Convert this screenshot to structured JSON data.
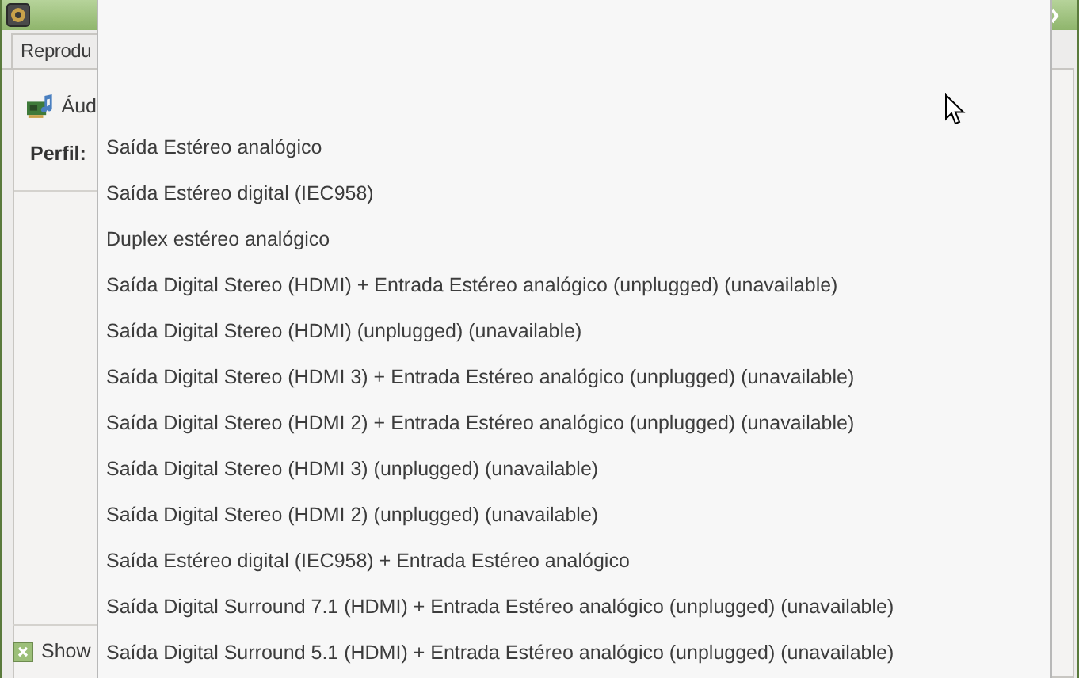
{
  "tabs": [
    {
      "label": "Reprodu",
      "selected": true
    }
  ],
  "device": {
    "name": "Áud",
    "profile_label": "Perfil:"
  },
  "show_checkbox": {
    "label": "Show",
    "checked": true
  },
  "profile_menu": {
    "items": [
      {
        "label": "Saída Estéreo analógico"
      },
      {
        "label": "Saída Estéreo digital (IEC958)"
      },
      {
        "label": "Duplex estéreo analógico"
      },
      {
        "label": "Saída Digital Stereo (HDMI) + Entrada Estéreo analógico (unplugged) (unavailable)"
      },
      {
        "label": "Saída Digital Stereo (HDMI) (unplugged) (unavailable)"
      },
      {
        "label": "Saída Digital Stereo (HDMI 3) + Entrada Estéreo analógico (unplugged) (unavailable)"
      },
      {
        "label": "Saída Digital Stereo (HDMI 2) + Entrada Estéreo analógico (unplugged) (unavailable)"
      },
      {
        "label": "Saída Digital Stereo (HDMI 3) (unplugged) (unavailable)"
      },
      {
        "label": "Saída Digital Stereo (HDMI 2) (unplugged) (unavailable)"
      },
      {
        "label": "Saída Estéreo digital (IEC958) + Entrada Estéreo analógico"
      },
      {
        "label": "Saída Digital Surround 7.1 (HDMI) + Entrada Estéreo analógico (unplugged) (unavailable)"
      },
      {
        "label": "Saída Digital Surround 5.1 (HDMI) + Entrada Estéreo analógico (unplugged) (unavailable)"
      }
    ]
  }
}
